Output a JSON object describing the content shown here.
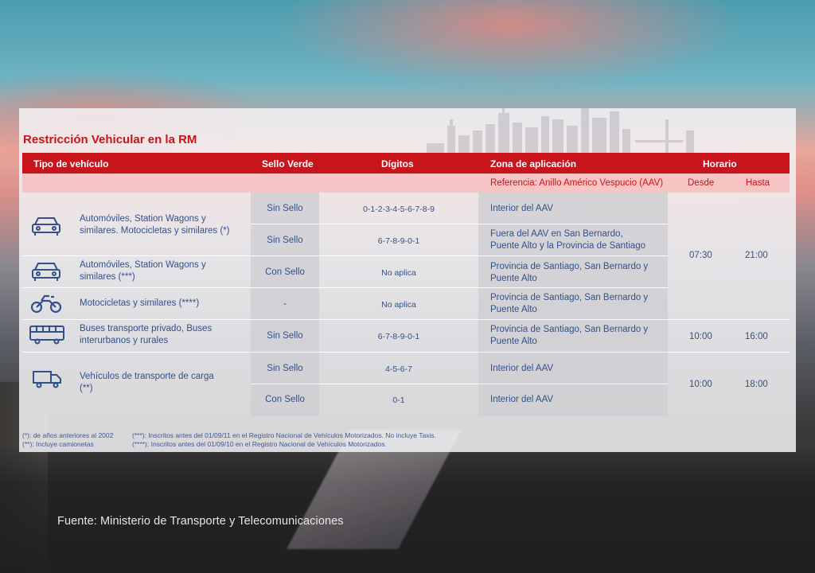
{
  "title": "Restricción Vehicular en la RM",
  "headers": {
    "tipo": "Tipo de vehículo",
    "sello": "Sello Verde",
    "digitos": "Dígitos",
    "zona": "Zona de aplicación",
    "horario": "Horario",
    "referencia": "Referencia: Anillo Américo Vespucio (AAV)",
    "desde": "Desde",
    "hasta": "Hasta"
  },
  "rows": [
    {
      "sello": "Sin Sello",
      "digitos": "0-1-2-3-4-5-6-7-8-9",
      "zona": "Interior del AAV"
    },
    {
      "sello": "Sin Sello",
      "digitos": "6-7-8-9-0-1",
      "zona_l1": "Fuera del AAV en San Bernardo,",
      "zona_l2": "Puente Alto y la Provincia de Santiago"
    },
    {
      "sello": "Con Sello",
      "digitos": "No aplica",
      "zona_l1": "Provincia de Santiago, San Bernardo y",
      "zona_l2": "Puente Alto"
    },
    {
      "sello": "-",
      "digitos": "No aplica",
      "zona_l1": "Provincia de Santiago, San Bernardo y",
      "zona_l2": "Puente Alto"
    },
    {
      "sello": "Sin Sello",
      "digitos": "6-7-8-9-0-1",
      "zona_l1": "Provincia de Santiago, San Bernardo y",
      "zona_l2": "Puente Alto"
    },
    {
      "sello": "Sin Sello",
      "digitos": "4-5-6-7",
      "zona": "Interior del AAV"
    },
    {
      "sello": "Con Sello",
      "digitos": "0-1",
      "zona": "Interior del AAV"
    }
  ],
  "vehicles": [
    {
      "icon": "car-icon",
      "l1": "Automóviles, Station Wagons y",
      "l2": "similares. Motocicletas y similares (*)"
    },
    {
      "icon": "car-icon",
      "l1": "Automóviles, Station Wagons y",
      "l2": "similares (***)"
    },
    {
      "icon": "motorcycle-icon",
      "l1": "Motocicletas y similares (****)"
    },
    {
      "icon": "bus-icon",
      "l1": "Buses transporte privado, Buses",
      "l2": "interurbanos y rurales"
    },
    {
      "icon": "truck-icon",
      "l1": "Vehículos de transporte de carga",
      "l2": "(**)"
    }
  ],
  "horarios": [
    {
      "desde": "07:30",
      "hasta": "21:00"
    },
    {
      "desde": "10:00",
      "hasta": "16:00"
    },
    {
      "desde": "10:00",
      "hasta": "18:00"
    }
  ],
  "notes": {
    "n1": "(*): de años anteriores al 2002",
    "n2": "(**): Incluye camionetas",
    "n3": "(***): Inscritos antes del 01/09/11 en el Registro Nacional de Vehículos Motorizados. No incluye Taxis.",
    "n4": "(****): Inscritos antes del 01/09/10 en el Registro Nacional de Vehículos Motorizados."
  },
  "source": "Fuente: Ministerio de Transporte y Telecomunicaciones",
  "colors": {
    "accent": "#c8141b",
    "text": "#33508a"
  }
}
